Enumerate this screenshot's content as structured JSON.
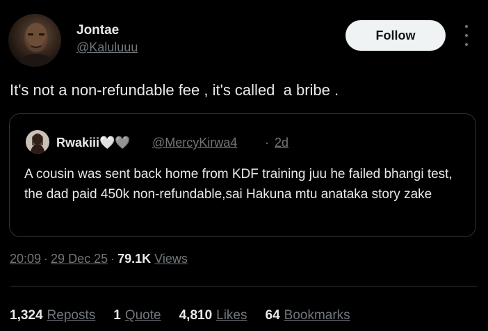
{
  "author": {
    "name": "Jontae",
    "handle": "@Kaluluuu",
    "avatar_icon": "profile-photo"
  },
  "actions": {
    "follow_label": "Follow",
    "more_icon": "more-vertical-icon"
  },
  "tweet": {
    "text": "It's not a non-refundable fee , it's called  a bribe ."
  },
  "quote": {
    "name": "Rwakiii🤍🩶",
    "handle": "@MercyKirwa4",
    "separator": "·",
    "time": "2d",
    "body": "A cousin was sent back home from KDF training juu he failed bhangi test, the dad paid 450k non-refundable,sai Hakuna mtu anataka story zake"
  },
  "meta": {
    "time": "20:09",
    "date": "29 Dec 25",
    "views_count": "79.1K",
    "views_label": "Views",
    "dot": "·"
  },
  "stats": {
    "reposts_count": "1,324",
    "reposts_label": "Reposts",
    "quotes_count": "1",
    "quotes_label": "Quote",
    "likes_count": "4,810",
    "likes_label": "Likes",
    "bookmarks_count": "64",
    "bookmarks_label": "Bookmarks"
  },
  "colors": {
    "background": "#000000",
    "primary_text": "#e7e9ea",
    "secondary_text": "#71767b",
    "border": "#2f3336",
    "follow_bg": "#eff3f4"
  }
}
